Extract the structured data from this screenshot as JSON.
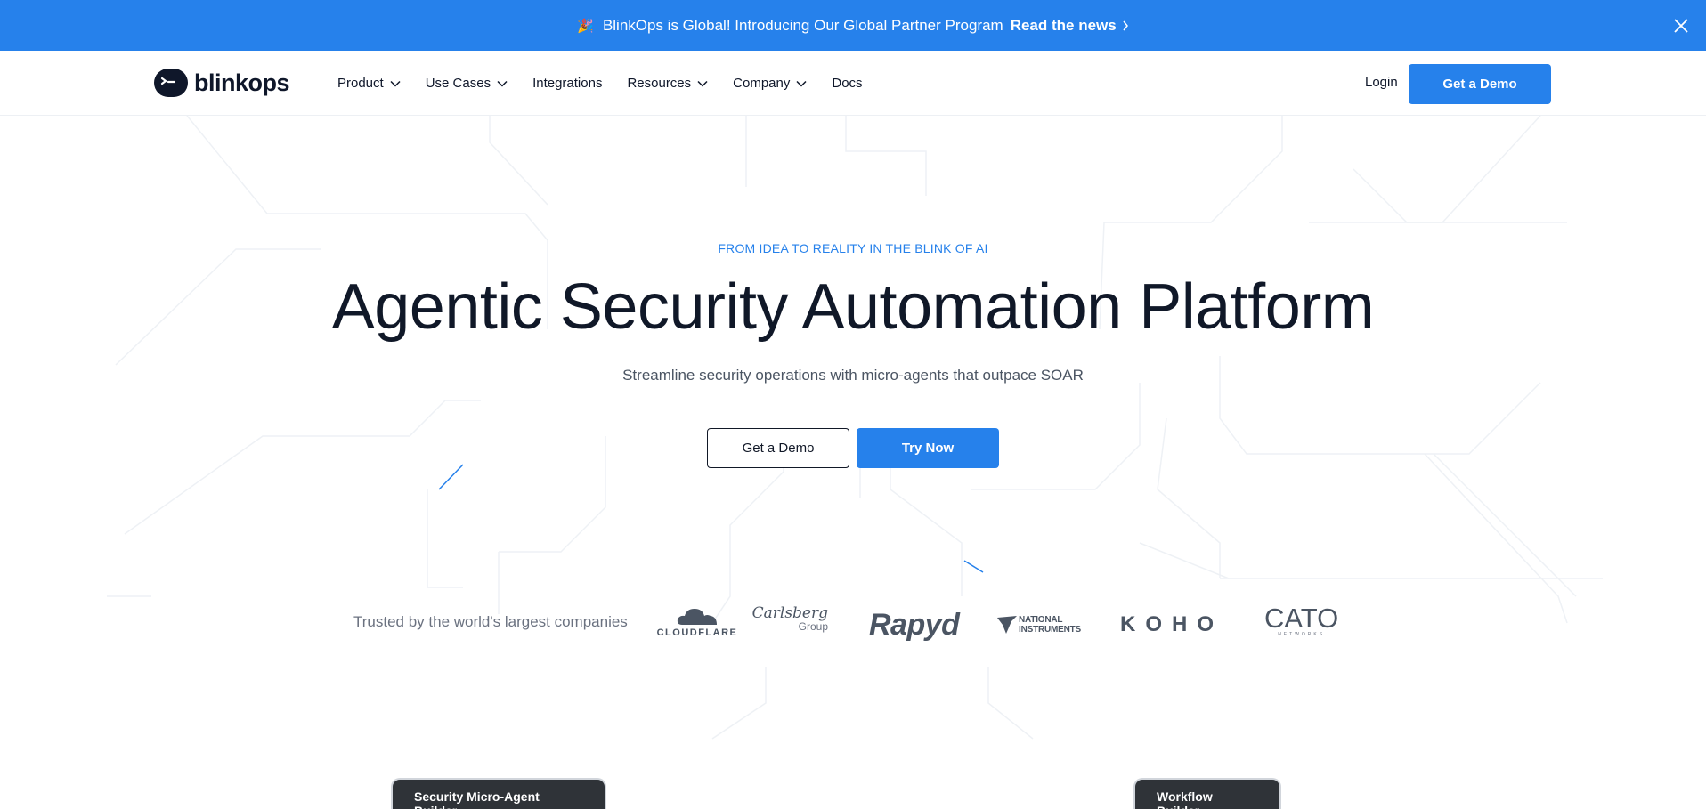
{
  "announcement": {
    "emoji": "🎉",
    "message": "BlinkOps is Global! Introducing Our Global Partner Program",
    "link_label": "Read the news",
    "chevron_icon": "chevron-right-icon",
    "close_icon": "close-icon",
    "background_color": "#2681eb"
  },
  "nav": {
    "logo_text": "blinkops",
    "items": [
      {
        "label": "Product",
        "has_dropdown": true
      },
      {
        "label": "Use Cases",
        "has_dropdown": true
      },
      {
        "label": "Integrations",
        "has_dropdown": false
      },
      {
        "label": "Resources",
        "has_dropdown": true
      },
      {
        "label": "Company",
        "has_dropdown": true
      },
      {
        "label": "Docs",
        "has_dropdown": false
      }
    ],
    "login_label": "Login",
    "demo_label": "Get a Demo"
  },
  "hero": {
    "kicker": "FROM IDEA TO REALITY IN THE BLINK OF AI",
    "title": "Agentic Security Automation Platform",
    "subtitle": "Streamline security operations with micro-agents that outpace SOAR",
    "demo_button": "Get a Demo",
    "try_button": "Try Now"
  },
  "trusted": {
    "label": "Trusted by the world's largest companies",
    "logos": {
      "cloudflare": "CLOUDFLARE",
      "carlsberg_a": "Carlsberg",
      "carlsberg_b": "Group",
      "rapyd": "Rapyd",
      "ni_a": "NATIONAL",
      "ni_b": "INSTRUMENTS",
      "koho": "KOHO",
      "cato_a": "CATO",
      "cato_b": "NETWORKS"
    }
  },
  "tabs": {
    "left": "Security Micro-Agent Builder",
    "right": "Workflow Builder"
  },
  "colors": {
    "accent": "#2681eb",
    "heading": "#101828",
    "muted": "#6b7280"
  }
}
